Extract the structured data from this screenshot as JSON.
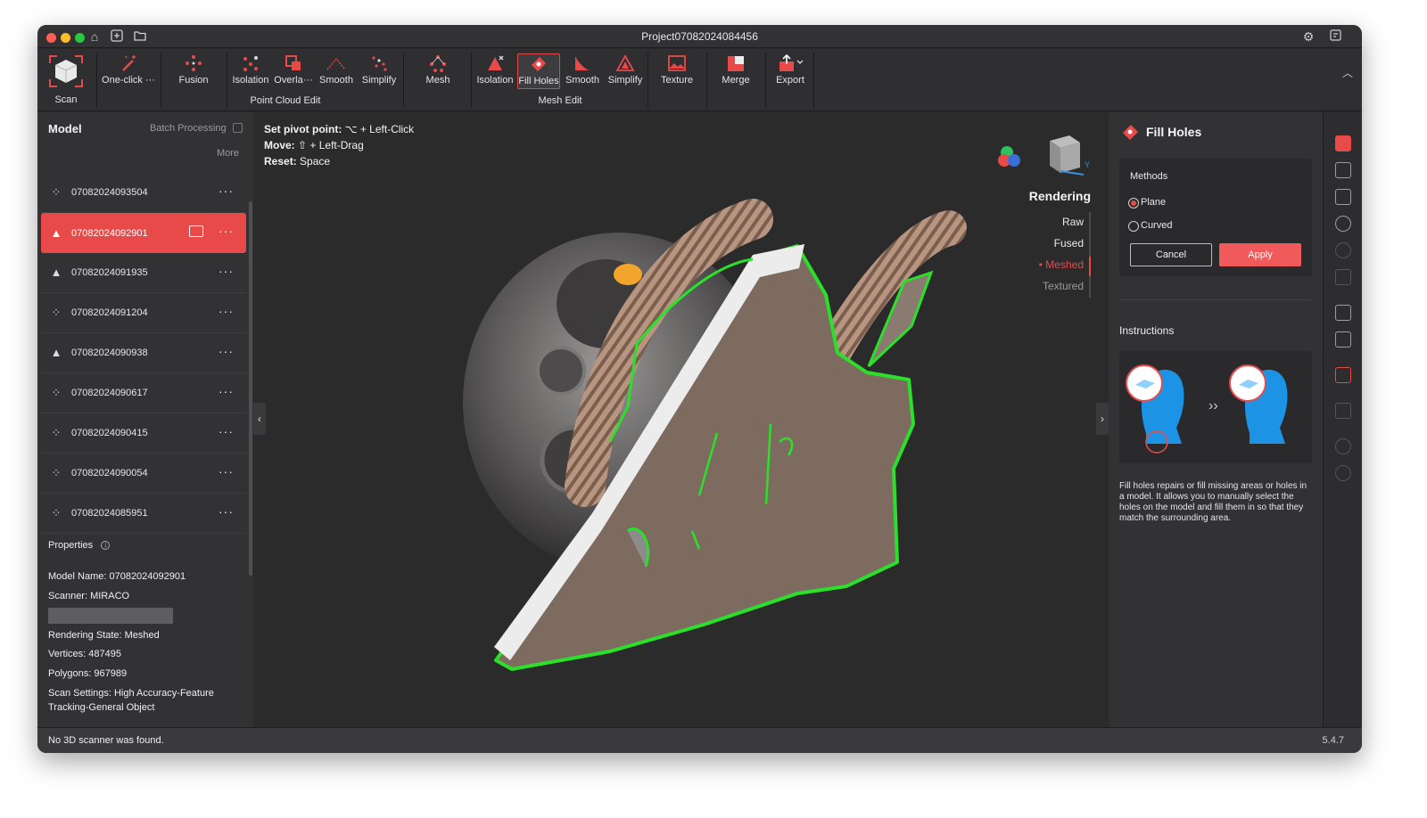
{
  "window": {
    "title": "Project07082024084456"
  },
  "toolbar": {
    "scan": "Scan",
    "tools": [
      {
        "label": "One-click ···"
      },
      {
        "label": "Fusion"
      },
      {
        "label": "Isolation"
      },
      {
        "label": "Overla···"
      },
      {
        "label": "Smooth"
      },
      {
        "label": "Simplify"
      },
      {
        "label": "Mesh"
      },
      {
        "label": "Isolation"
      },
      {
        "label": "Fill Holes"
      },
      {
        "label": "Smooth"
      },
      {
        "label": "Simplify"
      },
      {
        "label": "Texture"
      },
      {
        "label": "Merge"
      },
      {
        "label": "Export"
      }
    ],
    "groups": {
      "point_cloud": "Point Cloud Edit",
      "mesh": "Mesh Edit"
    },
    "active_tool": "Fill Holes"
  },
  "left_panel": {
    "title": "Model",
    "batch": "Batch Processing",
    "more": "More",
    "models": [
      {
        "name": "07082024093504",
        "icon": "point-cloud-icon"
      },
      {
        "name": "07082024092901",
        "icon": "mesh-icon",
        "active": true
      },
      {
        "name": "07082024091935",
        "icon": "mesh-icon"
      },
      {
        "name": "07082024091204",
        "icon": "point-cloud-icon"
      },
      {
        "name": "07082024090938",
        "icon": "mesh-icon"
      },
      {
        "name": "07082024090617",
        "icon": "point-cloud-icon"
      },
      {
        "name": "07082024090415",
        "icon": "point-cloud-icon"
      },
      {
        "name": "07082024090054",
        "icon": "point-cloud-icon"
      },
      {
        "name": "07082024085951",
        "icon": "point-cloud-icon"
      }
    ],
    "properties_title": "Properties",
    "properties": {
      "model_name": "Model Name:  07082024092901",
      "scanner": "Scanner:  MIRACO",
      "rendering_state": "Rendering State:  Meshed",
      "vertices": "Vertices:  487495",
      "polygons": "Polygons:  967989",
      "scan_settings_1": "Scan Settings:  High Accuracy-Feature",
      "scan_settings_2": "Tracking-General Object"
    }
  },
  "viewport": {
    "hint_pivot_label": "Set pivot point:",
    "hint_pivot_value": "⌥ + Left-Click",
    "hint_move_label": "Move:",
    "hint_move_value": "⇧ + Left-Drag",
    "hint_reset_label": "Reset:",
    "hint_reset_value": "Space",
    "rendering_title": "Rendering",
    "rendering_options": [
      "Raw",
      "Fused",
      "• Meshed",
      "Textured"
    ],
    "axis_label": "Y"
  },
  "right_panel": {
    "title": "Fill Holes",
    "methods_label": "Methods",
    "method_plane": "Plane",
    "method_curved": "Curved",
    "selected_method": "Plane",
    "cancel": "Cancel",
    "apply": "Apply",
    "instructions_title": "Instructions",
    "instructions_text": "Fill holes repairs or fill missing areas or holes in a model. It allows you to manually select the holes on the model and fill them in so that they match the surrounding area."
  },
  "status": {
    "message": "No 3D scanner was found.",
    "version": "5.4.7"
  },
  "colors": {
    "accent": "#e84a4a",
    "outline": "#2bd62b"
  }
}
